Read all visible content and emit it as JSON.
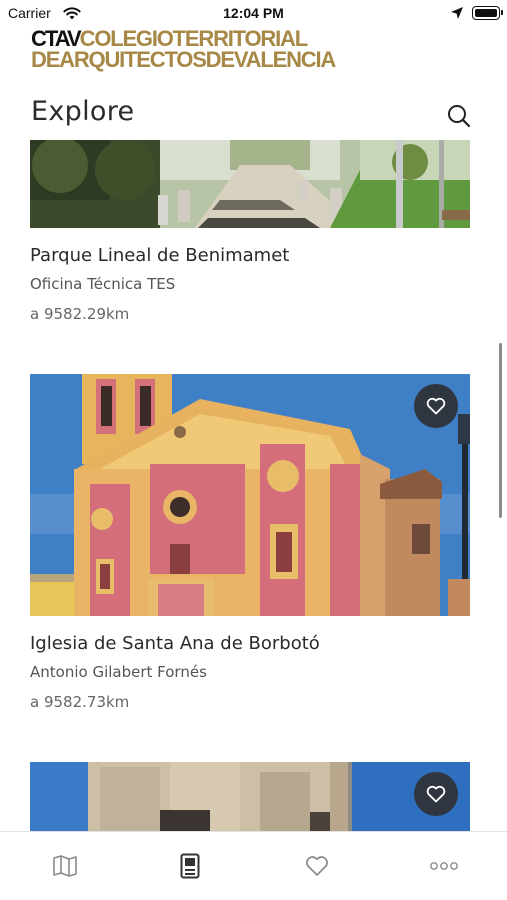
{
  "status_bar": {
    "carrier": "Carrier",
    "time": "12:04 PM",
    "wifi_icon": "wifi-icon",
    "location_icon": "location-arrow-icon",
    "battery_icon": "battery-icon"
  },
  "logo": {
    "ctav": "CTAV",
    "line1_rest": "COLEGIOTERRITORIAL",
    "line2": "DEARQUITECTOSDEVALENCIA",
    "brand_color": "#a78847"
  },
  "header": {
    "title": "Explore",
    "search_icon": "search-icon"
  },
  "cards": [
    {
      "title": "Parque Lineal de Benimamet",
      "author": "Oficina Técnica TES",
      "distance": "a 9582.29km",
      "image": "park-photo",
      "has_favorite_button": false
    },
    {
      "title": "Iglesia de Santa Ana de Borbotó",
      "author": "Antonio Gilabert Fornés",
      "distance": "a 9582.73km",
      "image": "church-photo",
      "has_favorite_button": true
    },
    {
      "title": "",
      "author": "",
      "distance": "",
      "image": "tower-photo",
      "has_favorite_button": true
    }
  ],
  "favorite_icon": "heart-outline-icon",
  "tab_bar": {
    "tabs": [
      {
        "icon": "map-icon",
        "selected": false
      },
      {
        "icon": "building-card-icon",
        "selected": true
      },
      {
        "icon": "heart-icon",
        "selected": false
      },
      {
        "icon": "more-dots-icon",
        "selected": false
      }
    ],
    "active_color": "#333333",
    "inactive_color": "#8a8a8a"
  }
}
